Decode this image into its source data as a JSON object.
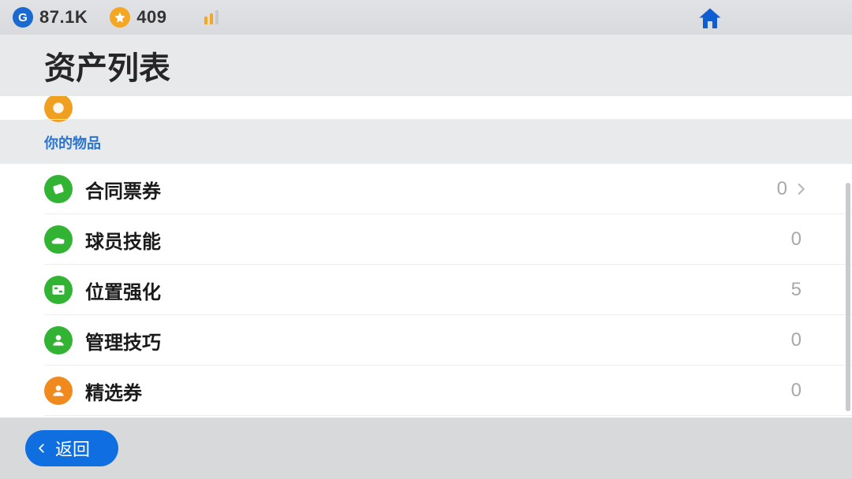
{
  "topbar": {
    "g_value": "87.1K",
    "star_value": "409"
  },
  "page_title": "资产列表",
  "section_header": "你的物品",
  "partial_row_above": {
    "label": "",
    "value": ""
  },
  "rows": [
    {
      "icon": "ticket",
      "icon_bg": "#33b334",
      "label": "合同票券",
      "value": "0",
      "has_chevron": true
    },
    {
      "icon": "boot",
      "icon_bg": "#33b334",
      "label": "球员技能",
      "value": "0",
      "has_chevron": false
    },
    {
      "icon": "position",
      "icon_bg": "#33b334",
      "label": "位置强化",
      "value": "5",
      "has_chevron": false
    },
    {
      "icon": "manager",
      "icon_bg": "#33b334",
      "label": "管理技巧",
      "value": "0",
      "has_chevron": false
    },
    {
      "icon": "featured",
      "icon_bg": "#f08a1e",
      "label": "精选券",
      "value": "0",
      "has_chevron": false
    }
  ],
  "back_label": "返回",
  "colors": {
    "accent": "#0f6fe0",
    "section_text": "#2b74cf"
  }
}
